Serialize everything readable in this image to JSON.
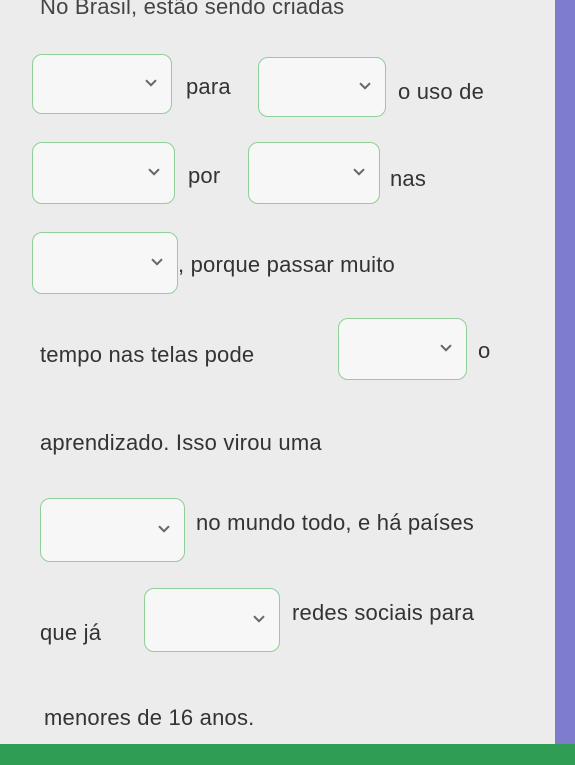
{
  "sentence": {
    "line1": "No Brasil, estão sendo criadas",
    "word_para": "para",
    "word_uso_de": "o uso de",
    "word_por": "por",
    "word_nas": "nas",
    "word_porque": ", porque passar muito",
    "word_tempo": "tempo nas telas pode",
    "word_o": "o",
    "word_aprendizado": "aprendizado. Isso virou uma",
    "word_mundo": "no mundo todo, e há países",
    "word_que_ja": "que já",
    "word_redes": "redes sociais para",
    "word_menores": "menores de 16 anos."
  },
  "dropdowns": [
    {
      "name": "blank-1",
      "value": ""
    },
    {
      "name": "blank-2",
      "value": ""
    },
    {
      "name": "blank-3",
      "value": ""
    },
    {
      "name": "blank-4",
      "value": ""
    },
    {
      "name": "blank-5",
      "value": ""
    },
    {
      "name": "blank-6",
      "value": ""
    },
    {
      "name": "blank-7",
      "value": ""
    },
    {
      "name": "blank-8",
      "value": ""
    }
  ],
  "colors": {
    "accent_border": "#8fcf98",
    "bottom_bar": "#2f9d53",
    "side_bar": "#7e7ccd"
  },
  "icons": {
    "dropdown": "chevron-down-icon"
  }
}
